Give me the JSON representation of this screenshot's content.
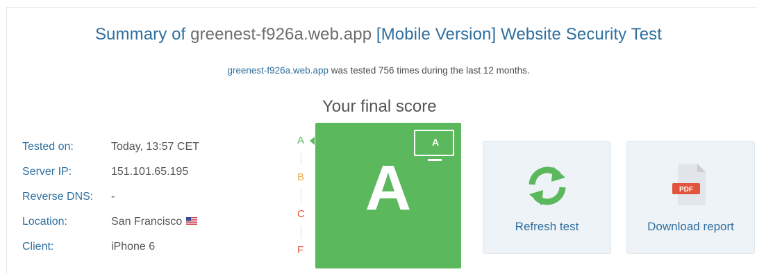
{
  "header": {
    "title_prefix": "Summary of ",
    "title_host": "greenest-f926a.web.app",
    "title_suffix": " [Mobile Version] Website Security Test",
    "subtitle_link": "greenest-f926a.web.app",
    "subtitle_text": " was tested 756 times during the last 12 months."
  },
  "score": {
    "heading": "Your final score",
    "grade": "A",
    "device_grade": "A",
    "scale": [
      "A",
      "B",
      "C",
      "F"
    ],
    "scale_colors": [
      "#5cb85c",
      "#f0ad4e",
      "#e2553c",
      "#e2553c"
    ],
    "box_color": "#5cb85c"
  },
  "info": {
    "rows": [
      {
        "label": "Tested on:",
        "value": "Today, 13:57 CET"
      },
      {
        "label": "Server IP:",
        "value": "151.101.65.195"
      },
      {
        "label": "Reverse DNS:",
        "value": "-"
      },
      {
        "label": "Location:",
        "value": "San Francisco"
      },
      {
        "label": "Client:",
        "value": "iPhone 6"
      }
    ],
    "location_flag": "us-flag-icon"
  },
  "actions": {
    "refresh_label": "Refresh test",
    "download_label": "Download report",
    "pdf_badge": "PDF"
  },
  "colors": {
    "link": "#2f6f9f",
    "green": "#5cb85c",
    "orange": "#f0ad4e",
    "red": "#e2553c"
  }
}
